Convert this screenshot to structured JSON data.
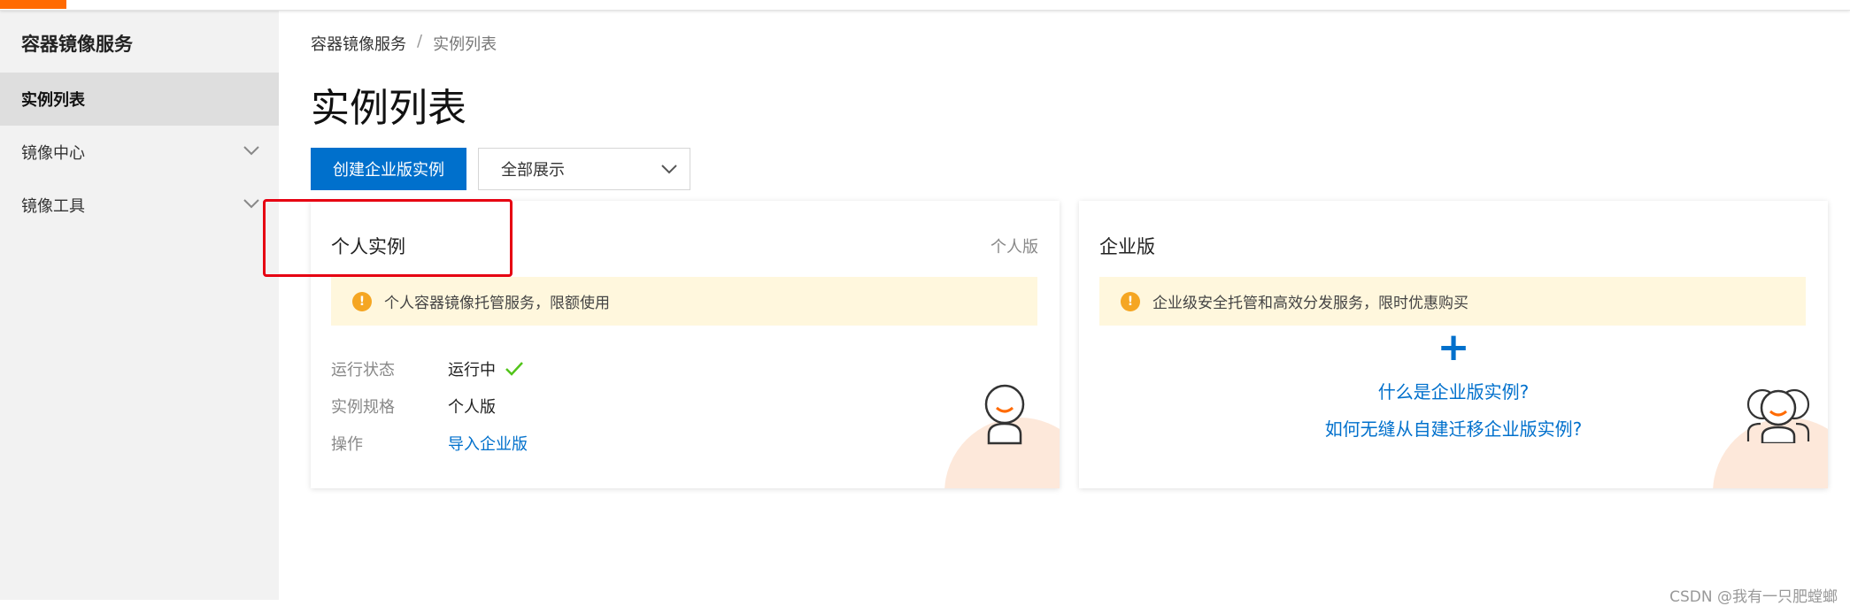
{
  "sidebar": {
    "title": "容器镜像服务",
    "items": [
      {
        "label": "实例列表"
      },
      {
        "label": "镜像中心"
      },
      {
        "label": "镜像工具"
      }
    ]
  },
  "breadcrumb": {
    "root": "容器镜像服务",
    "separator": "/",
    "current": "实例列表"
  },
  "page_title": "实例列表",
  "toolbar": {
    "create_label": "创建企业版实例",
    "filter_value": "全部展示"
  },
  "personal_card": {
    "title": "个人实例",
    "tag": "个人版",
    "notice": "个人容器镜像托管服务，限额使用",
    "fields": [
      {
        "label": "运行状态",
        "value": "运行中"
      },
      {
        "label": "实例规格",
        "value": "个人版"
      },
      {
        "label": "操作",
        "value": "导入企业版"
      }
    ]
  },
  "enterprise_card": {
    "title": "企业版",
    "notice": "企业级安全托管和高效分发服务，限时优惠购买",
    "plus": "+",
    "link_1": "什么是企业版实例?",
    "link_2": "如何无缝从自建迁移企业版实例?"
  },
  "colors": {
    "accent": "#ff6a00",
    "primary": "#0070cc",
    "highlight_box": "#e60012",
    "success": "#52c41a",
    "warning": "#f5a623"
  },
  "watermark": "CSDN @我有一只肥螳螂"
}
